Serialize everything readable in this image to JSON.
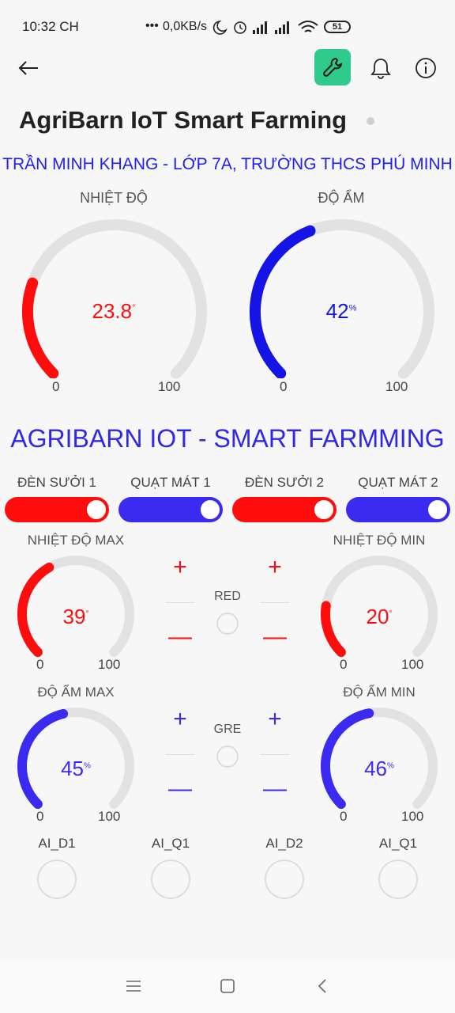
{
  "status": {
    "time": "10:32 CH",
    "network_speed": "0,0KB/s",
    "battery": "51"
  },
  "header": {
    "title": "AgriBarn IoT Smart Farming",
    "subtitle": "TRẦN MINH KHANG - LỚP 7A, TRƯỜNG THCS PHÚ MINH"
  },
  "gauges_top": [
    {
      "label": "NHIỆT ĐỘ",
      "value": "23.8",
      "unit": "°",
      "fraction": 0.238,
      "min": "0",
      "max": "100",
      "color": "#ff0d0d"
    },
    {
      "label": "ĐỘ ẨM",
      "value": "42",
      "unit": "%",
      "fraction": 0.42,
      "min": "0",
      "max": "100",
      "color": "#1414e6"
    }
  ],
  "section_title": "AGRIBARN IOT - SMART FARMMING",
  "switches": [
    {
      "label": "ĐÈN SƯỞI 1",
      "color": "#ff0d0d",
      "on": true
    },
    {
      "label": "QUẠT MÁT 1",
      "color": "#3b2bf0",
      "on": true
    },
    {
      "label": "ĐÈN SƯỞI 2",
      "color": "#ff0d0d",
      "on": true
    },
    {
      "label": "QUẠT MÁT 2",
      "color": "#3b2bf0",
      "on": true
    }
  ],
  "small_gauges": [
    {
      "label": "NHIỆT ĐỘ MAX",
      "value": "39",
      "unit": "°",
      "fraction": 0.39,
      "min": "0",
      "max": "100",
      "color": "#ff0d0d"
    },
    {
      "label": "NHIỆT ĐỘ MIN",
      "value": "20",
      "unit": "°",
      "fraction": 0.2,
      "min": "0",
      "max": "100",
      "color": "#ff0d0d"
    },
    {
      "label": "ĐỘ ẨM MAX",
      "value": "45",
      "unit": "%",
      "fraction": 0.45,
      "min": "0",
      "max": "100",
      "color": "#3b2bf0"
    },
    {
      "label": "ĐỘ ẨM MIN",
      "value": "46",
      "unit": "%",
      "fraction": 0.46,
      "min": "0",
      "max": "100",
      "color": "#3b2bf0"
    }
  ],
  "steppers": {
    "plus": "+",
    "minus": "—",
    "red_color": "#ff0d0d",
    "blue_color": "#3b2bf0"
  },
  "leds": {
    "red_label": "RED",
    "green_label": "GRE"
  },
  "ai_indicators": [
    "AI_D1",
    "AI_Q1",
    "AI_D2",
    "AI_Q1"
  ],
  "icons": {
    "back": "arrow-left-icon",
    "settings": "wrench-icon",
    "notifications": "bell-icon",
    "info": "info-icon"
  }
}
